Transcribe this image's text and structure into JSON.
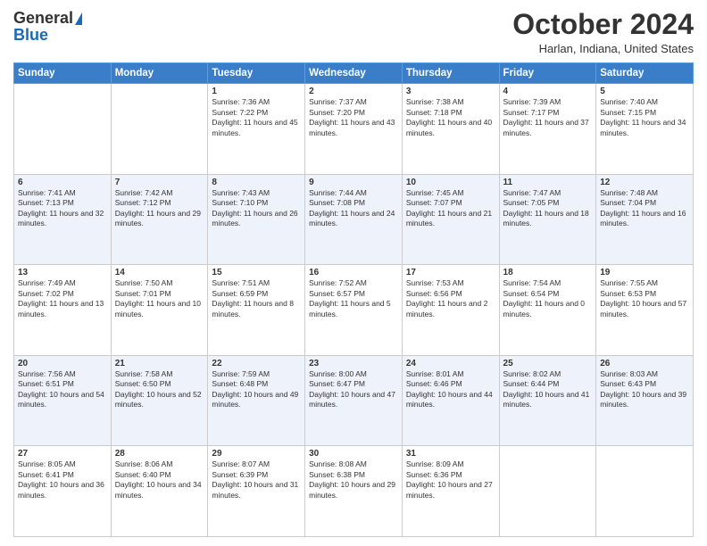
{
  "header": {
    "logo_general": "General",
    "logo_blue": "Blue",
    "month_title": "October 2024",
    "location": "Harlan, Indiana, United States"
  },
  "weekdays": [
    "Sunday",
    "Monday",
    "Tuesday",
    "Wednesday",
    "Thursday",
    "Friday",
    "Saturday"
  ],
  "weeks": [
    [
      {
        "day": "",
        "sunrise": "",
        "sunset": "",
        "daylight": ""
      },
      {
        "day": "",
        "sunrise": "",
        "sunset": "",
        "daylight": ""
      },
      {
        "day": "1",
        "sunrise": "Sunrise: 7:36 AM",
        "sunset": "Sunset: 7:22 PM",
        "daylight": "Daylight: 11 hours and 45 minutes."
      },
      {
        "day": "2",
        "sunrise": "Sunrise: 7:37 AM",
        "sunset": "Sunset: 7:20 PM",
        "daylight": "Daylight: 11 hours and 43 minutes."
      },
      {
        "day": "3",
        "sunrise": "Sunrise: 7:38 AM",
        "sunset": "Sunset: 7:18 PM",
        "daylight": "Daylight: 11 hours and 40 minutes."
      },
      {
        "day": "4",
        "sunrise": "Sunrise: 7:39 AM",
        "sunset": "Sunset: 7:17 PM",
        "daylight": "Daylight: 11 hours and 37 minutes."
      },
      {
        "day": "5",
        "sunrise": "Sunrise: 7:40 AM",
        "sunset": "Sunset: 7:15 PM",
        "daylight": "Daylight: 11 hours and 34 minutes."
      }
    ],
    [
      {
        "day": "6",
        "sunrise": "Sunrise: 7:41 AM",
        "sunset": "Sunset: 7:13 PM",
        "daylight": "Daylight: 11 hours and 32 minutes."
      },
      {
        "day": "7",
        "sunrise": "Sunrise: 7:42 AM",
        "sunset": "Sunset: 7:12 PM",
        "daylight": "Daylight: 11 hours and 29 minutes."
      },
      {
        "day": "8",
        "sunrise": "Sunrise: 7:43 AM",
        "sunset": "Sunset: 7:10 PM",
        "daylight": "Daylight: 11 hours and 26 minutes."
      },
      {
        "day": "9",
        "sunrise": "Sunrise: 7:44 AM",
        "sunset": "Sunset: 7:08 PM",
        "daylight": "Daylight: 11 hours and 24 minutes."
      },
      {
        "day": "10",
        "sunrise": "Sunrise: 7:45 AM",
        "sunset": "Sunset: 7:07 PM",
        "daylight": "Daylight: 11 hours and 21 minutes."
      },
      {
        "day": "11",
        "sunrise": "Sunrise: 7:47 AM",
        "sunset": "Sunset: 7:05 PM",
        "daylight": "Daylight: 11 hours and 18 minutes."
      },
      {
        "day": "12",
        "sunrise": "Sunrise: 7:48 AM",
        "sunset": "Sunset: 7:04 PM",
        "daylight": "Daylight: 11 hours and 16 minutes."
      }
    ],
    [
      {
        "day": "13",
        "sunrise": "Sunrise: 7:49 AM",
        "sunset": "Sunset: 7:02 PM",
        "daylight": "Daylight: 11 hours and 13 minutes."
      },
      {
        "day": "14",
        "sunrise": "Sunrise: 7:50 AM",
        "sunset": "Sunset: 7:01 PM",
        "daylight": "Daylight: 11 hours and 10 minutes."
      },
      {
        "day": "15",
        "sunrise": "Sunrise: 7:51 AM",
        "sunset": "Sunset: 6:59 PM",
        "daylight": "Daylight: 11 hours and 8 minutes."
      },
      {
        "day": "16",
        "sunrise": "Sunrise: 7:52 AM",
        "sunset": "Sunset: 6:57 PM",
        "daylight": "Daylight: 11 hours and 5 minutes."
      },
      {
        "day": "17",
        "sunrise": "Sunrise: 7:53 AM",
        "sunset": "Sunset: 6:56 PM",
        "daylight": "Daylight: 11 hours and 2 minutes."
      },
      {
        "day": "18",
        "sunrise": "Sunrise: 7:54 AM",
        "sunset": "Sunset: 6:54 PM",
        "daylight": "Daylight: 11 hours and 0 minutes."
      },
      {
        "day": "19",
        "sunrise": "Sunrise: 7:55 AM",
        "sunset": "Sunset: 6:53 PM",
        "daylight": "Daylight: 10 hours and 57 minutes."
      }
    ],
    [
      {
        "day": "20",
        "sunrise": "Sunrise: 7:56 AM",
        "sunset": "Sunset: 6:51 PM",
        "daylight": "Daylight: 10 hours and 54 minutes."
      },
      {
        "day": "21",
        "sunrise": "Sunrise: 7:58 AM",
        "sunset": "Sunset: 6:50 PM",
        "daylight": "Daylight: 10 hours and 52 minutes."
      },
      {
        "day": "22",
        "sunrise": "Sunrise: 7:59 AM",
        "sunset": "Sunset: 6:48 PM",
        "daylight": "Daylight: 10 hours and 49 minutes."
      },
      {
        "day": "23",
        "sunrise": "Sunrise: 8:00 AM",
        "sunset": "Sunset: 6:47 PM",
        "daylight": "Daylight: 10 hours and 47 minutes."
      },
      {
        "day": "24",
        "sunrise": "Sunrise: 8:01 AM",
        "sunset": "Sunset: 6:46 PM",
        "daylight": "Daylight: 10 hours and 44 minutes."
      },
      {
        "day": "25",
        "sunrise": "Sunrise: 8:02 AM",
        "sunset": "Sunset: 6:44 PM",
        "daylight": "Daylight: 10 hours and 41 minutes."
      },
      {
        "day": "26",
        "sunrise": "Sunrise: 8:03 AM",
        "sunset": "Sunset: 6:43 PM",
        "daylight": "Daylight: 10 hours and 39 minutes."
      }
    ],
    [
      {
        "day": "27",
        "sunrise": "Sunrise: 8:05 AM",
        "sunset": "Sunset: 6:41 PM",
        "daylight": "Daylight: 10 hours and 36 minutes."
      },
      {
        "day": "28",
        "sunrise": "Sunrise: 8:06 AM",
        "sunset": "Sunset: 6:40 PM",
        "daylight": "Daylight: 10 hours and 34 minutes."
      },
      {
        "day": "29",
        "sunrise": "Sunrise: 8:07 AM",
        "sunset": "Sunset: 6:39 PM",
        "daylight": "Daylight: 10 hours and 31 minutes."
      },
      {
        "day": "30",
        "sunrise": "Sunrise: 8:08 AM",
        "sunset": "Sunset: 6:38 PM",
        "daylight": "Daylight: 10 hours and 29 minutes."
      },
      {
        "day": "31",
        "sunrise": "Sunrise: 8:09 AM",
        "sunset": "Sunset: 6:36 PM",
        "daylight": "Daylight: 10 hours and 27 minutes."
      },
      {
        "day": "",
        "sunrise": "",
        "sunset": "",
        "daylight": ""
      },
      {
        "day": "",
        "sunrise": "",
        "sunset": "",
        "daylight": ""
      }
    ]
  ]
}
